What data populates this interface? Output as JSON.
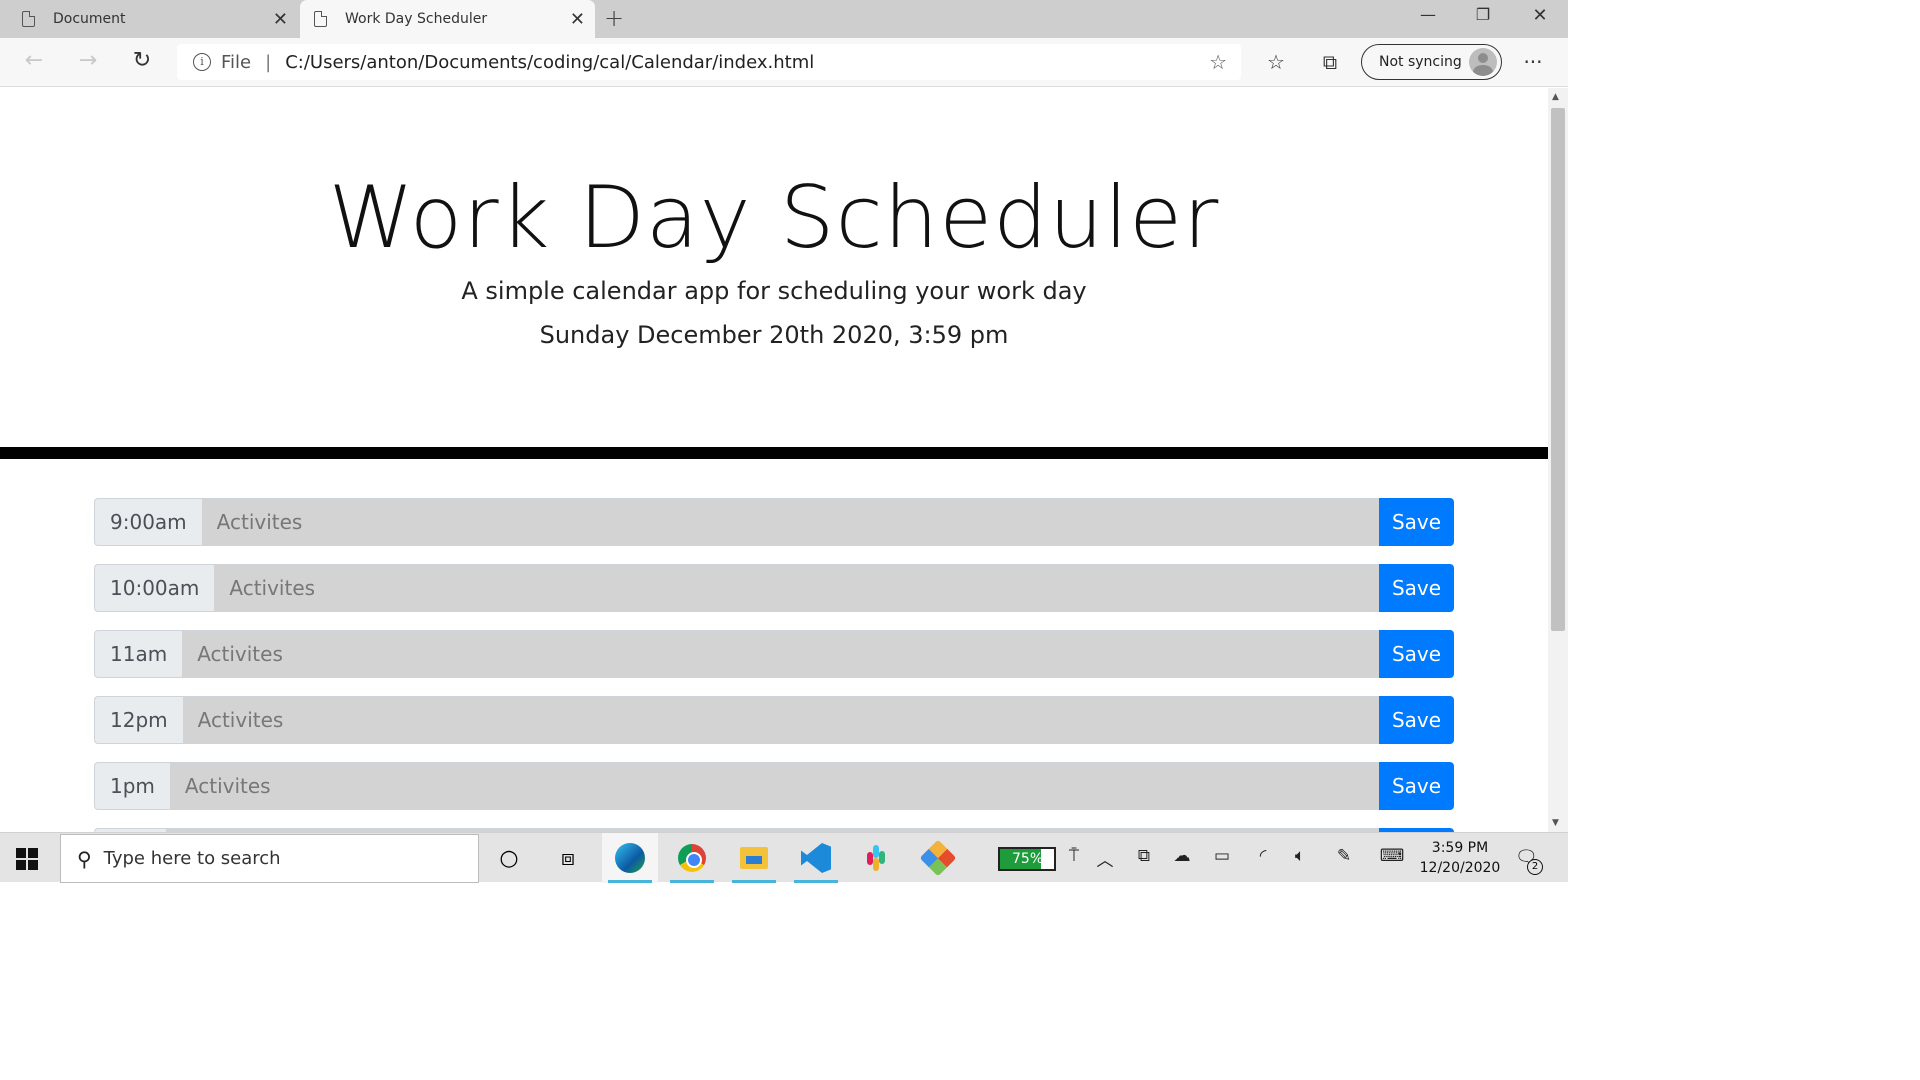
{
  "browser": {
    "tabs": [
      {
        "label": "Document",
        "active": false
      },
      {
        "label": "Work Day Scheduler",
        "active": true
      }
    ],
    "address": {
      "scheme": "File",
      "url": "C:/Users/anton/Documents/coding/cal/Calendar/index.html"
    },
    "profile_label": "Not syncing",
    "icons": {
      "back": "back-arrow-icon",
      "forward": "forward-arrow-icon",
      "reload": "reload-icon",
      "favorite": "star-icon",
      "favorites": "favorites-list-icon",
      "collections": "collections-icon",
      "more": "more-icon"
    }
  },
  "page": {
    "title": "Work Day Scheduler",
    "lead": "A simple calendar app for scheduling your work day",
    "current_day": "Sunday December 20th 2020, 3:59 pm",
    "accent_color": "#007bff",
    "past_row_color": "#d3d3d3",
    "rows": [
      {
        "hour": "9:00am",
        "placeholder": "Activites",
        "save_label": "Save"
      },
      {
        "hour": "10:00am",
        "placeholder": "Activites",
        "save_label": "Save"
      },
      {
        "hour": "11am",
        "placeholder": "Activites",
        "save_label": "Save"
      },
      {
        "hour": "12pm",
        "placeholder": "Activites",
        "save_label": "Save"
      },
      {
        "hour": "1pm",
        "placeholder": "Activites",
        "save_label": "Save"
      }
    ]
  },
  "taskbar": {
    "search_placeholder": "Type here to search",
    "battery_level": "75%",
    "time": "3:59 PM",
    "date": "12/20/2020",
    "notification_count": "2"
  }
}
